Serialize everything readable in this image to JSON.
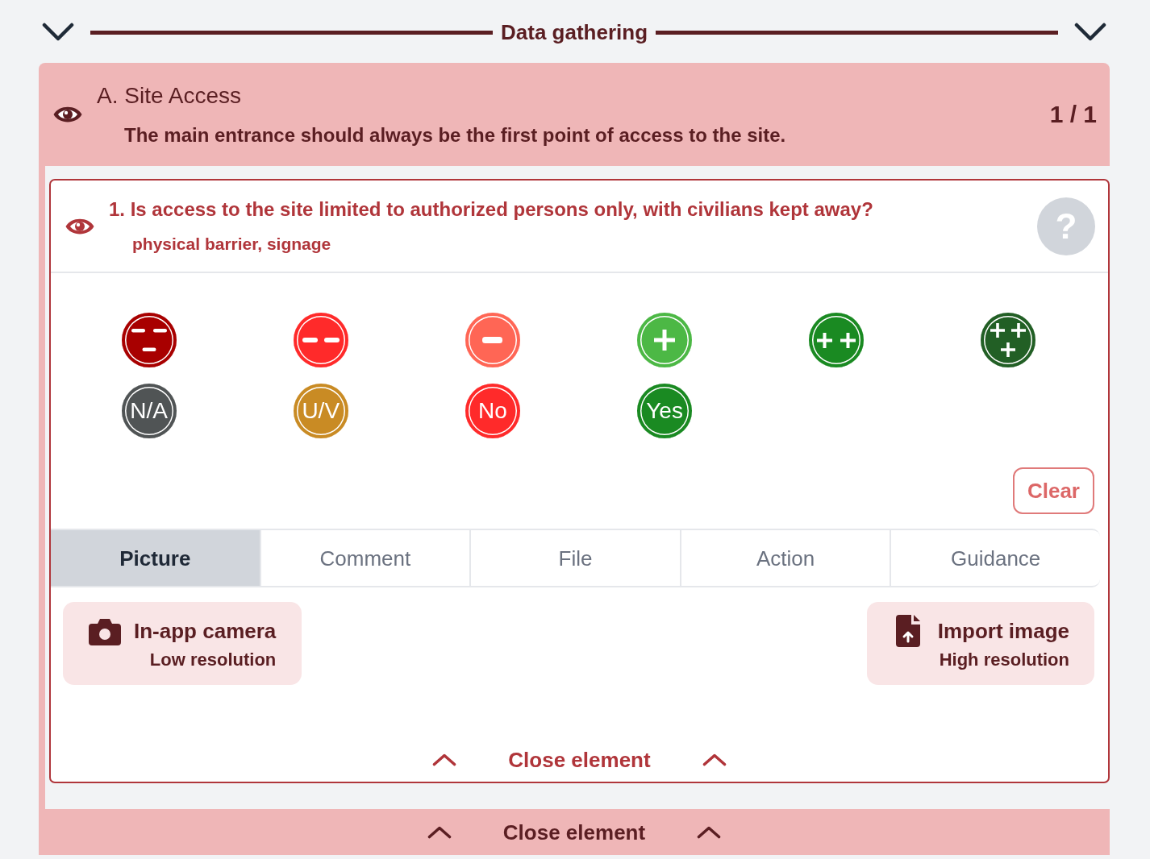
{
  "header_bar": {
    "title": "Data gathering"
  },
  "section": {
    "title": "A. Site Access",
    "description": "The main entrance should always be the first point of access to the site.",
    "counter": "1 / 1",
    "question": {
      "text": "1. Is access to the site limited to authorized persons only, with civilians kept away?",
      "hint": "physical barrier, signage",
      "help": "?",
      "answers": [
        {
          "kind": "minus3",
          "color": "#a80000",
          "selected": false
        },
        {
          "kind": "minus2",
          "color": "#ff2a2a",
          "selected": false
        },
        {
          "kind": "minus1",
          "color": "#ff6655",
          "selected": false
        },
        {
          "kind": "plus1",
          "color": "#4cb845",
          "selected": false
        },
        {
          "kind": "plus2",
          "color": "#1a8a22",
          "selected": false
        },
        {
          "kind": "plus3",
          "color": "#225f25",
          "selected": false
        },
        {
          "kind": "label",
          "label": "N/A",
          "color": "#505455",
          "selected": false
        },
        {
          "kind": "label",
          "label": "U/V",
          "color": "#c98b24",
          "selected": false
        },
        {
          "kind": "label",
          "label": "No",
          "color": "#ff2a2a",
          "selected": false
        },
        {
          "kind": "label",
          "label": "Yes",
          "color": "#1a8a22",
          "selected": false
        }
      ],
      "clear": "Clear",
      "tabs": [
        {
          "label": "Picture",
          "selected": true
        },
        {
          "label": "Comment",
          "selected": false
        },
        {
          "label": "File",
          "selected": false
        },
        {
          "label": "Action",
          "selected": false
        },
        {
          "label": "Guidance",
          "selected": false
        }
      ],
      "picture_actions": [
        {
          "kind": "camera",
          "title": "In-app camera",
          "subtitle": "Low resolution"
        },
        {
          "kind": "import",
          "title": "Import image",
          "subtitle": "High resolution"
        }
      ],
      "close": "Close element"
    },
    "close": "Close element"
  }
}
